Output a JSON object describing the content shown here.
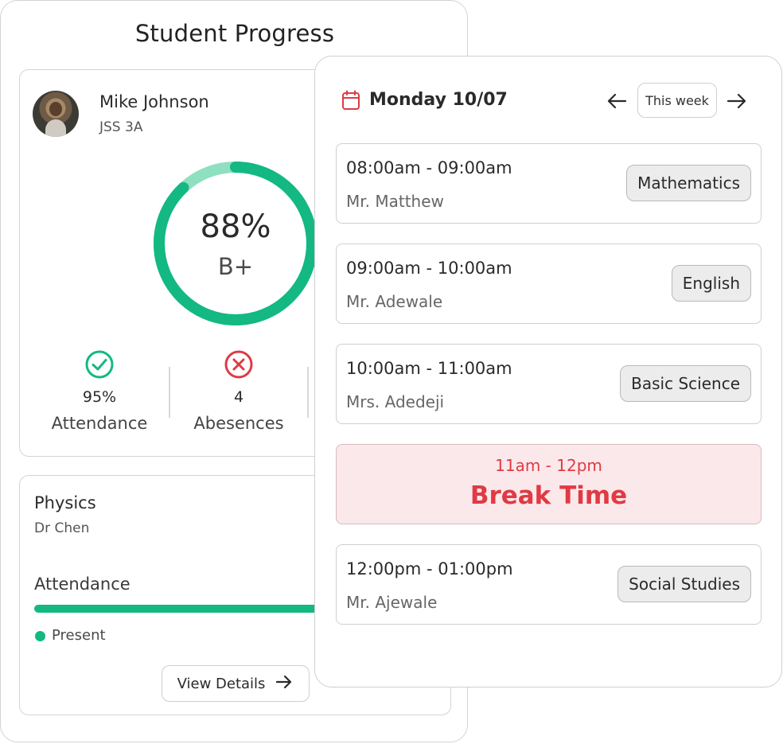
{
  "back_card": {
    "title": "Student Progress",
    "student": {
      "name": "Mike Johnson",
      "class": "JSS 3A",
      "score_percent": 88,
      "score_label": "88%",
      "grade": "B+"
    },
    "stats": [
      {
        "value": "95%",
        "label": "Attendance",
        "icon": "check-circle-icon",
        "color": "#13b883"
      },
      {
        "value": "4",
        "label": "Abesences",
        "icon": "x-circle-icon",
        "color": "#e03a44"
      }
    ],
    "course": {
      "name": "Physics",
      "teacher": "Dr Chen",
      "attendance_title": "Attendance",
      "legend_label": "Present",
      "view_details_label": "View Details"
    }
  },
  "schedule": {
    "date_label": "Monday 10/07",
    "week_button_label": "This week",
    "slots": [
      {
        "time": "08:00am - 09:00am",
        "teacher": "Mr. Matthew",
        "subject": "Mathematics"
      },
      {
        "time": "09:00am - 10:00am",
        "teacher": "Mr. Adewale",
        "subject": "English"
      },
      {
        "time": "10:00am - 11:00am",
        "teacher": "Mrs. Adedeji",
        "subject": "Basic Science"
      },
      {
        "time": "12:00pm - 01:00pm",
        "teacher": "Mr. Ajewale",
        "subject": "Social Studies"
      }
    ],
    "break": {
      "time": "11am - 12pm",
      "label": "Break Time"
    }
  },
  "colors": {
    "accent_green": "#13b883",
    "ring_track": "#8fdfc1",
    "alert_red": "#e03a44",
    "break_bg": "#fbe8ea"
  }
}
